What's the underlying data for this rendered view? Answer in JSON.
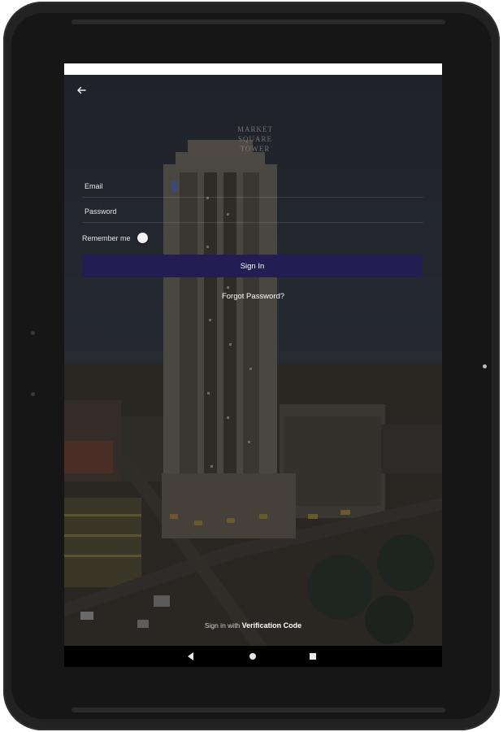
{
  "screen": {
    "logo_lines": [
      "MARKET",
      "SQUARE",
      "TOWER"
    ]
  },
  "form": {
    "email_label": "Email",
    "password_label": "Password",
    "remember_label": "Remember me",
    "remember_checked": false,
    "signin_label": "Sign In",
    "forgot_label": "Forgot Password?"
  },
  "footer": {
    "verify_prefix": "Sign in with",
    "verify_link": "Verification Code"
  },
  "colors": {
    "accent": "#231d53",
    "overlay": "#1e1e22"
  },
  "icons": {
    "back": "arrow-left-icon",
    "nav_back": "triangle-back-icon",
    "nav_home": "circle-home-icon",
    "nav_recent": "square-recent-icon"
  }
}
